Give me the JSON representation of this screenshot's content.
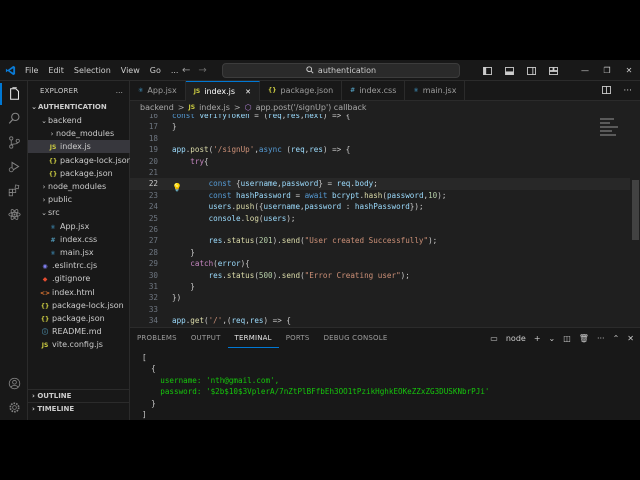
{
  "window": {
    "menu": [
      "File",
      "Edit",
      "Selection",
      "View",
      "Go",
      "..."
    ],
    "search_text": "authentication",
    "controls": {
      "minimize": "—",
      "restore": "❐",
      "close": "✕"
    }
  },
  "sidebar": {
    "title": "EXPLORER",
    "more": "...",
    "root": "AUTHENTICATION",
    "items": [
      {
        "label": "backend",
        "kind": "folder-open",
        "depth": 1
      },
      {
        "label": "node_modules",
        "kind": "folder",
        "depth": 2
      },
      {
        "label": "index.js",
        "kind": "js",
        "depth": 2,
        "selected": true
      },
      {
        "label": "package-lock.json",
        "kind": "json",
        "depth": 2
      },
      {
        "label": "package.json",
        "kind": "json",
        "depth": 2
      },
      {
        "label": "node_modules",
        "kind": "folder",
        "depth": 1
      },
      {
        "label": "public",
        "kind": "folder",
        "depth": 1
      },
      {
        "label": "src",
        "kind": "folder-open",
        "depth": 1
      },
      {
        "label": "App.jsx",
        "kind": "react",
        "depth": 2
      },
      {
        "label": "index.css",
        "kind": "css",
        "depth": 2
      },
      {
        "label": "main.jsx",
        "kind": "react",
        "depth": 2
      },
      {
        "label": ".eslintrc.cjs",
        "kind": "eslint",
        "depth": 1
      },
      {
        "label": ".gitignore",
        "kind": "git",
        "depth": 1
      },
      {
        "label": "index.html",
        "kind": "html",
        "depth": 1
      },
      {
        "label": "package-lock.json",
        "kind": "json",
        "depth": 1
      },
      {
        "label": "package.json",
        "kind": "json",
        "depth": 1
      },
      {
        "label": "README.md",
        "kind": "md",
        "depth": 1
      },
      {
        "label": "vite.config.js",
        "kind": "js",
        "depth": 1
      }
    ],
    "outline": "OUTLINE",
    "timeline": "TIMELINE"
  },
  "tabs": [
    {
      "label": "App.jsx",
      "icon": "react",
      "active": false
    },
    {
      "label": "index.js",
      "icon": "js",
      "active": true,
      "close": "✕"
    },
    {
      "label": "package.json",
      "icon": "json",
      "active": false
    },
    {
      "label": "index.css",
      "icon": "css",
      "active": false
    },
    {
      "label": "main.jsx",
      "icon": "react",
      "active": false
    }
  ],
  "breadcrumb": [
    "backend",
    ">",
    "index.js",
    ">",
    "app.post('/signUp') callback"
  ],
  "editor": {
    "lines": [
      {
        "n": "16",
        "text": "const verifyToken = (req,res,next) => {"
      },
      {
        "n": "17",
        "text": "}"
      },
      {
        "n": "18",
        "text": ""
      },
      {
        "n": "19",
        "text": "app.post('/signUp',async (req,res) => {"
      },
      {
        "n": "20",
        "text": "    try{"
      },
      {
        "n": "21",
        "text": ""
      },
      {
        "n": "22",
        "text": "        const {username,password} = req.body;",
        "current": true
      },
      {
        "n": "23",
        "text": "        const hashPassword = await bcrypt.hash(password,10);"
      },
      {
        "n": "24",
        "text": "        users.push({username,password : hashPassword});"
      },
      {
        "n": "25",
        "text": "        console.log(users);"
      },
      {
        "n": "26",
        "text": ""
      },
      {
        "n": "27",
        "text": "        res.status(201).send(\"User created Successfully\");"
      },
      {
        "n": "28",
        "text": "    }"
      },
      {
        "n": "29",
        "text": "    catch(error){"
      },
      {
        "n": "30",
        "text": "        res.status(500).send(\"Error Creating user\");"
      },
      {
        "n": "31",
        "text": "    }"
      },
      {
        "n": "32",
        "text": "})"
      },
      {
        "n": "33",
        "text": ""
      },
      {
        "n": "34",
        "text": "app.get('/',(req,res) => {"
      }
    ]
  },
  "panel": {
    "tabs": [
      "PROBLEMS",
      "OUTPUT",
      "TERMINAL",
      "PORTS",
      "DEBUG CONSOLE"
    ],
    "active_tab": "TERMINAL",
    "shell": "node",
    "terminal_lines": [
      "[",
      "  {",
      "    username: 'nth@gmail.com',",
      "    password: '$2b$10$3VplerA/7nZtPlBFfbEh3OO1tPzikHghkEOKeZZxZG3DUSKNbrPJi'",
      "  }",
      "]"
    ]
  },
  "colors": {
    "accent": "#0078d4",
    "editor_bg": "#1f1f1f",
    "chrome_bg": "#181818"
  }
}
